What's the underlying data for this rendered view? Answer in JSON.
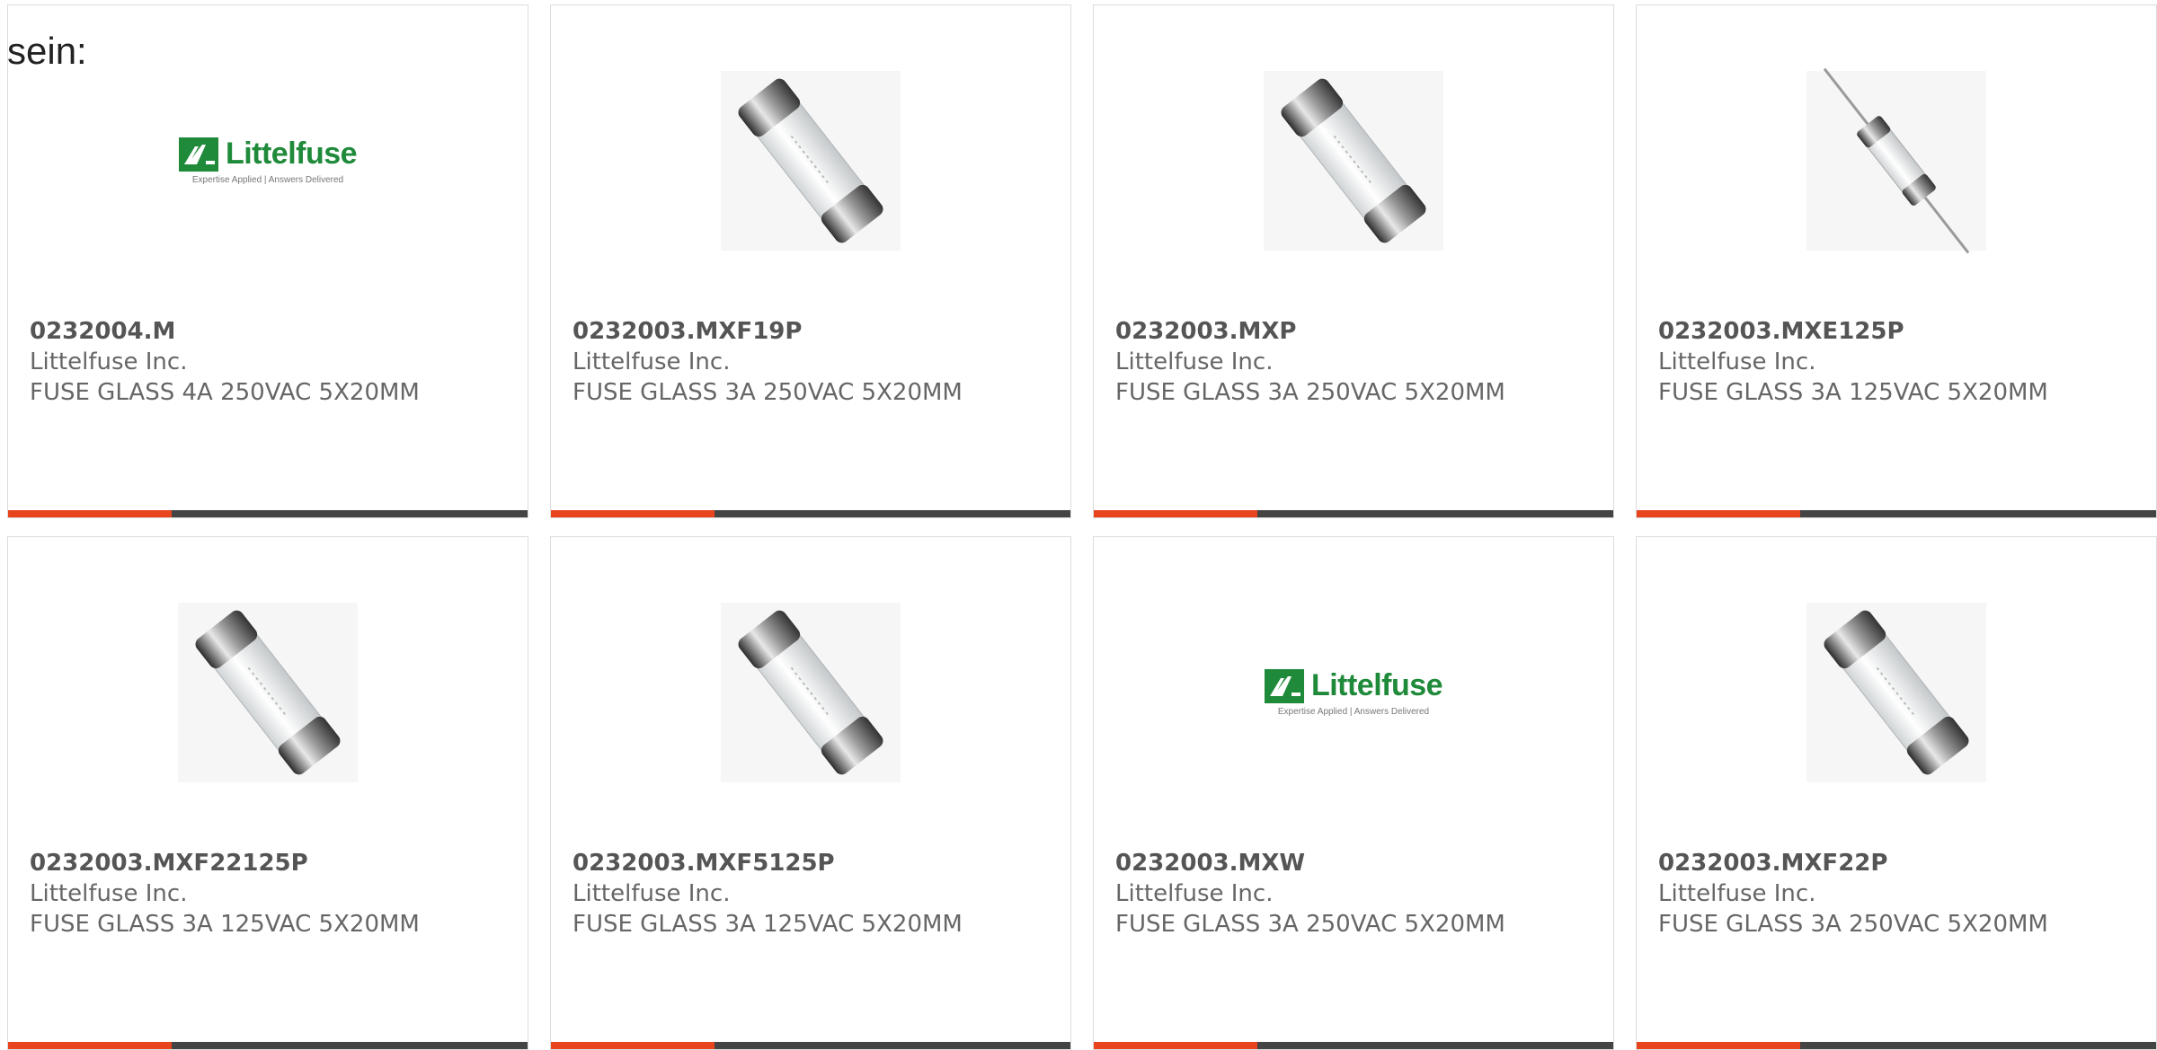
{
  "intro_text": "sein:",
  "colors": {
    "accent": "#e8451e",
    "bar": "#444444",
    "brand_green": "#1f8a3a"
  },
  "products": [
    {
      "part": "0232004.M",
      "manufacturer": "Littelfuse Inc.",
      "description": "FUSE GLASS 4A 250VAC 5X20MM",
      "image": "logo"
    },
    {
      "part": "0232003.MXF19P",
      "manufacturer": "Littelfuse Inc.",
      "description": "FUSE GLASS 3A 250VAC 5X20MM",
      "image": "fuse"
    },
    {
      "part": "0232003.MXP",
      "manufacturer": "Littelfuse Inc.",
      "description": "FUSE GLASS 3A 250VAC 5X20MM",
      "image": "fuse"
    },
    {
      "part": "0232003.MXE125P",
      "manufacturer": "Littelfuse Inc.",
      "description": "FUSE GLASS 3A 125VAC 5X20MM",
      "image": "fuse-leaded"
    },
    {
      "part": "0232003.MXF22125P",
      "manufacturer": "Littelfuse Inc.",
      "description": "FUSE GLASS 3A 125VAC 5X20MM",
      "image": "fuse"
    },
    {
      "part": "0232003.MXF5125P",
      "manufacturer": "Littelfuse Inc.",
      "description": "FUSE GLASS 3A 125VAC 5X20MM",
      "image": "fuse"
    },
    {
      "part": "0232003.MXW",
      "manufacturer": "Littelfuse Inc.",
      "description": "FUSE GLASS 3A 250VAC 5X20MM",
      "image": "logo"
    },
    {
      "part": "0232003.MXF22P",
      "manufacturer": "Littelfuse Inc.",
      "description": "FUSE GLASS 3A 250VAC 5X20MM",
      "image": "fuse"
    }
  ],
  "logo": {
    "wordmark": "Littelfuse",
    "tagline": "Expertise Applied | Answers Delivered"
  }
}
